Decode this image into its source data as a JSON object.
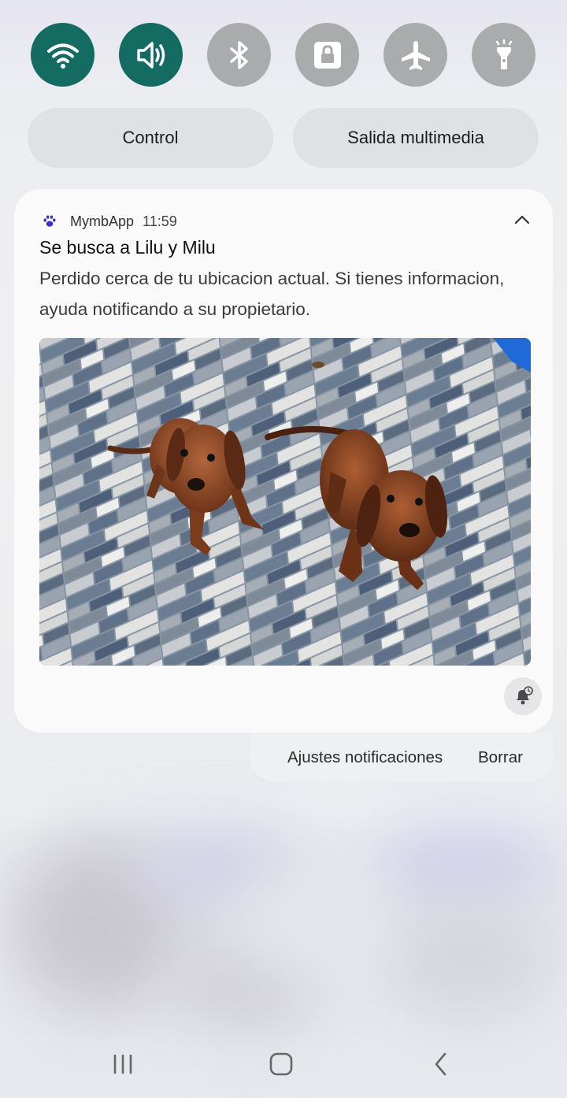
{
  "quick_toggles": [
    {
      "icon": "wifi-icon",
      "state": "on"
    },
    {
      "icon": "sound-icon",
      "state": "on"
    },
    {
      "icon": "bluetooth-icon",
      "state": "off"
    },
    {
      "icon": "rotation-lock-icon",
      "state": "off"
    },
    {
      "icon": "airplane-icon",
      "state": "off"
    },
    {
      "icon": "flashlight-icon",
      "state": "off"
    }
  ],
  "pills": {
    "control_label": "Control",
    "media_output_label": "Salida multimedia"
  },
  "notification": {
    "app_icon": "paw-icon",
    "app_name": "MymbApp",
    "time": "11:59",
    "title": "Se busca a Lilu y Milu",
    "body": "Perdido cerca de tu ubicacion actual. Si tienes informacion, ayuda notificando a su propietario.",
    "image": "two-dachshunds-photo"
  },
  "actions": {
    "settings_label": "Ajustes notificaciones",
    "clear_label": "Borrar"
  },
  "nav": {
    "recents": "recents-icon",
    "home": "home-icon",
    "back": "back-icon"
  },
  "colors": {
    "toggle_on": "#136b62",
    "toggle_off": "#a9abad",
    "card_bg": "#fafafa"
  }
}
